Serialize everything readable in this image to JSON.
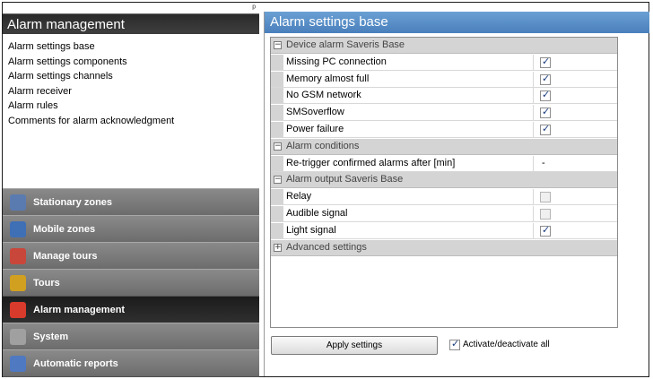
{
  "left": {
    "pin_glyph": "ᵖ",
    "title": "Alarm management",
    "links": [
      "Alarm settings base",
      "Alarm settings components",
      "Alarm settings channels",
      "Alarm receiver",
      "Alarm rules",
      "Comments for alarm acknowledgment"
    ],
    "categories": [
      {
        "label": "Stationary zones",
        "icon": "stationary-zones-icon",
        "color": "#5a7bb0",
        "active": false
      },
      {
        "label": "Mobile zones",
        "icon": "mobile-zones-icon",
        "color": "#3f6fb5",
        "active": false
      },
      {
        "label": "Manage tours",
        "icon": "calendar-icon",
        "color": "#c8473a",
        "active": false
      },
      {
        "label": "Tours",
        "icon": "tours-icon",
        "color": "#d2a020",
        "active": false
      },
      {
        "label": "Alarm management",
        "icon": "alarm-icon",
        "color": "#d83a2c",
        "active": true
      },
      {
        "label": "System",
        "icon": "system-tools-icon",
        "color": "#a0a0a0",
        "active": false
      },
      {
        "label": "Automatic reports",
        "icon": "reports-icon",
        "color": "#4f79c0",
        "active": false
      }
    ]
  },
  "right": {
    "title": "Alarm settings base",
    "sections": [
      {
        "toggle": "−",
        "label": "Device alarm Saveris Base",
        "items": [
          {
            "label": "Missing PC connection",
            "checked": true
          },
          {
            "label": "Memory almost full",
            "checked": true
          },
          {
            "label": "No GSM network",
            "checked": true
          },
          {
            "label": "SMSoverflow",
            "checked": true
          },
          {
            "label": "Power failure",
            "checked": true
          }
        ]
      },
      {
        "toggle": "−",
        "label": "Alarm conditions",
        "items": [
          {
            "label": "Re-trigger confirmed alarms after [min]",
            "value": "-"
          }
        ]
      },
      {
        "toggle": "−",
        "label": "Alarm output Saveris Base",
        "items": [
          {
            "label": "Relay",
            "checked": false
          },
          {
            "label": "Audible signal",
            "checked": false
          },
          {
            "label": "Light signal",
            "checked": true
          }
        ]
      },
      {
        "toggle": "+",
        "label": "Advanced settings",
        "items": []
      }
    ],
    "apply_label": "Apply settings",
    "activate_all_label": "Activate/deactivate all",
    "activate_all_checked": true
  }
}
